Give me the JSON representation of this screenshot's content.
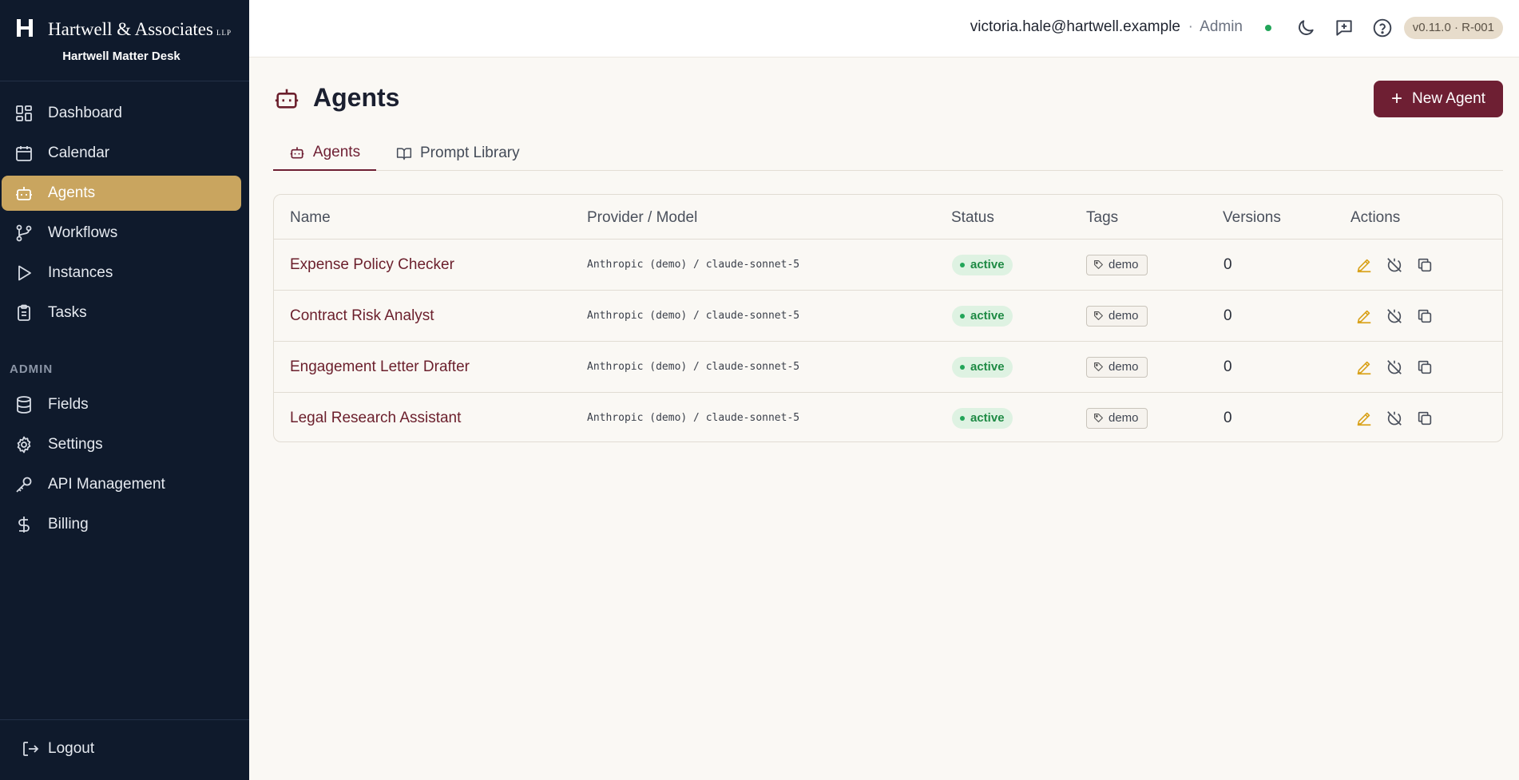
{
  "brand": {
    "name": "Hartwell & Associates",
    "suffix": "LLP",
    "subtitle": "Hartwell Matter Desk"
  },
  "sidebar": {
    "items": [
      {
        "label": "Dashboard",
        "icon": "dashboard-icon"
      },
      {
        "label": "Calendar",
        "icon": "calendar-icon"
      },
      {
        "label": "Agents",
        "icon": "robot-icon",
        "active": true
      },
      {
        "label": "Workflows",
        "icon": "workflow-icon"
      },
      {
        "label": "Instances",
        "icon": "play-icon"
      },
      {
        "label": "Tasks",
        "icon": "clipboard-icon"
      }
    ],
    "admin_label": "ADMIN",
    "admin_items": [
      {
        "label": "Fields",
        "icon": "database-icon"
      },
      {
        "label": "Settings",
        "icon": "gear-icon"
      },
      {
        "label": "API Management",
        "icon": "key-icon"
      },
      {
        "label": "Billing",
        "icon": "dollar-icon"
      }
    ],
    "logout_label": "Logout"
  },
  "topbar": {
    "email": "victoria.hale@hartwell.example",
    "separator": "·",
    "role": "Admin",
    "version": "v0.11.0 · R-001",
    "status_color": "#22a559"
  },
  "page": {
    "title": "Agents",
    "new_button_label": "New Agent",
    "tabs": [
      {
        "label": "Agents",
        "active": true
      },
      {
        "label": "Prompt Library",
        "active": false
      }
    ]
  },
  "table": {
    "columns": [
      "Name",
      "Provider / Model",
      "Status",
      "Tags",
      "Versions",
      "Actions"
    ],
    "rows": [
      {
        "name": "Expense Policy Checker",
        "model": "Anthropic (demo) / claude-sonnet-5",
        "status": "active",
        "tag": "demo",
        "versions": "0"
      },
      {
        "name": "Contract Risk Analyst",
        "model": "Anthropic (demo) / claude-sonnet-5",
        "status": "active",
        "tag": "demo",
        "versions": "0"
      },
      {
        "name": "Engagement Letter Drafter",
        "model": "Anthropic (demo) / claude-sonnet-5",
        "status": "active",
        "tag": "demo",
        "versions": "0"
      },
      {
        "name": "Legal Research Assistant",
        "model": "Anthropic (demo) / claude-sonnet-5",
        "status": "active",
        "tag": "demo",
        "versions": "0"
      }
    ]
  },
  "colors": {
    "sidebar_bg": "#0f1a2c",
    "active_nav": "#c9a55f",
    "accent": "#6e1f33",
    "edit_icon": "#d9a21b"
  }
}
